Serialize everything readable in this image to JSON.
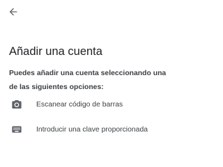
{
  "header": {
    "back_icon": "arrow-back-icon"
  },
  "main": {
    "title": "Añadir una cuenta",
    "description": "Puedes añadir una cuenta seleccionando una de las siguientes opciones:",
    "options": [
      {
        "icon": "camera-icon",
        "label": "Escanear código de barras"
      },
      {
        "icon": "keyboard-icon",
        "label": "Introducir una clave proporcionada"
      }
    ]
  },
  "colors": {
    "background": "#ffffff",
    "title_text": "#202124",
    "body_text": "#3c4043",
    "icon": "#5f6368"
  }
}
